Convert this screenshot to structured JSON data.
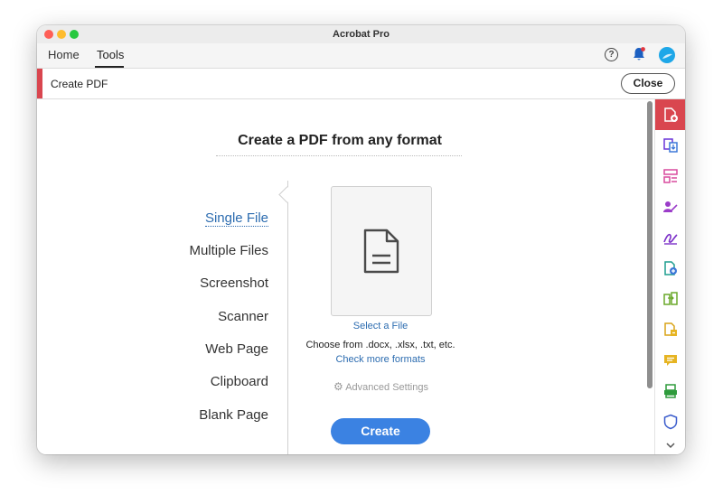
{
  "window": {
    "title": "Acrobat Pro"
  },
  "tabs": {
    "home": "Home",
    "tools": "Tools"
  },
  "header_icons": [
    "help-icon",
    "notifications-bell-icon",
    "profile-avatar"
  ],
  "tool_header": {
    "name": "Create PDF",
    "close_label": "Close"
  },
  "main": {
    "heading": "Create a PDF from any format",
    "options": [
      "Single File",
      "Multiple Files",
      "Screenshot",
      "Scanner",
      "Web Page",
      "Clipboard",
      "Blank Page"
    ],
    "selected_option": "Single File",
    "select_file_label": "Select a File",
    "choose_text": "Choose from .docx, .xlsx, .txt, etc.",
    "check_more_label": "Check more formats",
    "advanced_label": "Advanced Settings",
    "create_label": "Create"
  },
  "right_panel": {
    "icons": [
      "create-pdf-icon",
      "export-pdf-icon",
      "organize-pages-icon",
      "request-signatures-icon",
      "fill-sign-icon",
      "edit-pdf-icon",
      "compare-files-icon",
      "combine-files-icon",
      "comment-icon",
      "scan-ocr-icon",
      "protect-icon"
    ],
    "active_icon": "create-pdf-icon"
  },
  "colors": {
    "accent_red": "#d9464f",
    "link_blue": "#2c6cb0",
    "button_blue": "#3b82e2"
  }
}
